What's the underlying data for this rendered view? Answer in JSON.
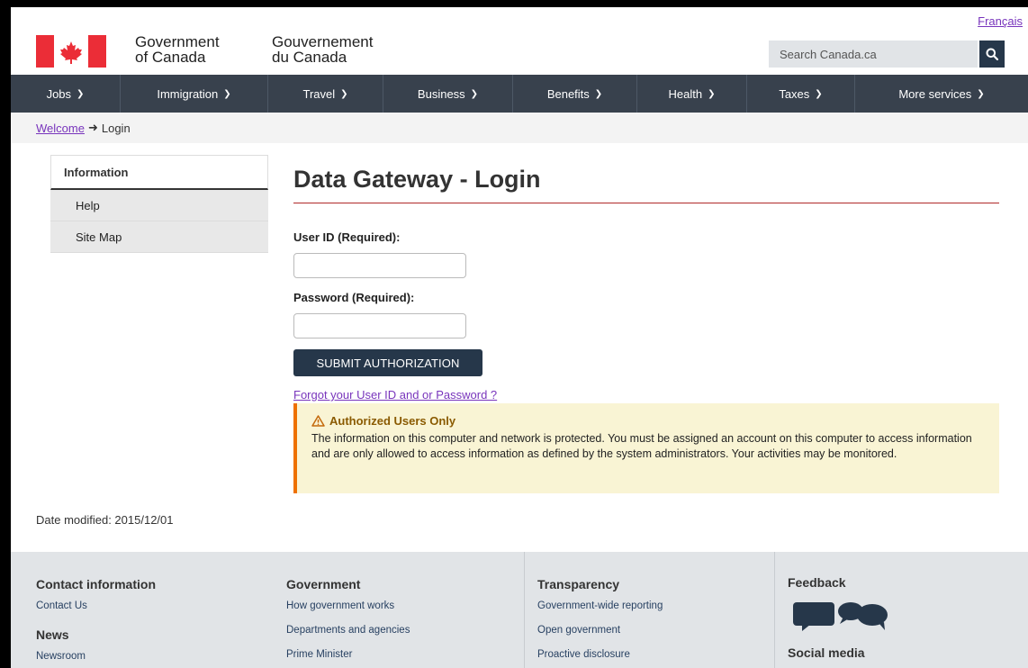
{
  "header": {
    "language_link": "Français",
    "signature_en_line1": "Government",
    "signature_en_line2": "of Canada",
    "signature_fr_line1": "Gouvernement",
    "signature_fr_line2": "du Canada",
    "search_placeholder": "Search Canada.ca",
    "search_icon": "search-icon"
  },
  "nav": {
    "items": [
      {
        "label": "Jobs"
      },
      {
        "label": "Immigration"
      },
      {
        "label": "Travel"
      },
      {
        "label": "Business"
      },
      {
        "label": "Benefits"
      },
      {
        "label": "Health"
      },
      {
        "label": "Taxes"
      },
      {
        "label": "More services"
      }
    ]
  },
  "breadcrumb": {
    "home": "Welcome",
    "current": "Login"
  },
  "sidebar": {
    "heading": "Information",
    "items": [
      {
        "label": "Help"
      },
      {
        "label": "Site Map"
      }
    ]
  },
  "main": {
    "title": "Data Gateway - Login",
    "userid_label": "User ID (Required):",
    "userid_value": "",
    "password_label": "Password (Required):",
    "password_value": "",
    "submit_label": "SUBMIT AUTHORIZATION",
    "forgot_link": "Forgot your User ID and or Password ?"
  },
  "alert": {
    "icon": "warning-icon",
    "title": "Authorized Users Only",
    "body": "The information on this computer and network is protected. You must be assigned an account on this computer to access information and are only allowed to access information as defined by the system administrators. Your activities may be monitored."
  },
  "date_modified": "Date modified: 2015/12/01",
  "footer": {
    "contact_heading": "Contact information",
    "contact_link": "Contact Us",
    "news_heading": "News",
    "news_link": "Newsroom",
    "government_heading": "Government",
    "government_links": [
      "How government works",
      "Departments and agencies",
      "Prime Minister"
    ],
    "transparency_heading": "Transparency",
    "transparency_links": [
      "Government-wide reporting",
      "Open government",
      "Proactive disclosure"
    ],
    "feedback_heading": "Feedback",
    "feedback_icon": "feedback-icon",
    "social_heading": "Social media"
  },
  "colors": {
    "nav_bg": "#38414d",
    "primary_button": "#26374a",
    "flag_red": "#eb2d37",
    "link": "#7834bc",
    "alert_bg": "#f9f4d4",
    "alert_border": "#ee7100"
  }
}
